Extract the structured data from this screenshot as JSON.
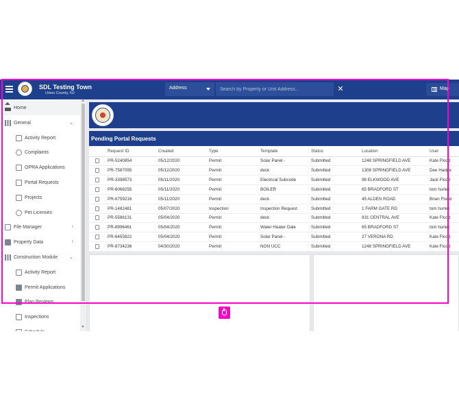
{
  "header": {
    "title": "SDL Testing Town",
    "subtitle": "Union County, NJ",
    "address_select": "Address",
    "search_placeholder": "Search by Property or Unit Address...",
    "clear_icon": "close-icon",
    "map_label": "Map",
    "bar_color": "#1d3f8c"
  },
  "sidebar": {
    "items": [
      {
        "label": "Home",
        "icon": "home-icon",
        "level": "top",
        "active": true
      },
      {
        "label": "General",
        "icon": "bank-icon",
        "level": "top",
        "chevron": "down"
      },
      {
        "label": "Activity Report",
        "icon": "chart-icon",
        "level": "child"
      },
      {
        "label": "Complaints",
        "icon": "alert-icon",
        "level": "child"
      },
      {
        "label": "OPRA Applications",
        "icon": "folder-icon",
        "level": "child"
      },
      {
        "label": "Portal Requests",
        "icon": "inbox-icon",
        "level": "child"
      },
      {
        "label": "Projects",
        "icon": "tree-icon",
        "level": "child"
      },
      {
        "label": "Pet Licenses",
        "icon": "paw-icon",
        "level": "child"
      },
      {
        "label": "File Manager",
        "icon": "folder-icon",
        "level": "top",
        "chevron": "left"
      },
      {
        "label": "Property Data",
        "icon": "building-icon",
        "level": "top",
        "chevron": "left"
      },
      {
        "label": "Construction Module",
        "icon": "grid-icon",
        "level": "top",
        "chevron": "down"
      },
      {
        "label": "Activity Report",
        "icon": "chart-icon",
        "level": "child"
      },
      {
        "label": "Permit Applications",
        "icon": "checkbox-icon",
        "level": "child"
      },
      {
        "label": "Plan Reviews",
        "icon": "pencil-icon",
        "level": "child"
      },
      {
        "label": "Inspections",
        "icon": "phone-icon",
        "level": "child"
      },
      {
        "label": "Schedule",
        "icon": "calendar-icon",
        "level": "child"
      }
    ]
  },
  "panel": {
    "title": "Pending Portal Requests",
    "columns": [
      "",
      "Request ID",
      "Created",
      "Type",
      "Template",
      "Status",
      "Location",
      "User"
    ],
    "rows": [
      [
        "PR-5240854",
        "05/12/2020",
        "Permit",
        "Solar Panel -",
        "Submitted",
        "1248 SPRINGFIELD AVE",
        "Kate Flood"
      ],
      [
        "PR-7587095",
        "05/12/2020",
        "Permit",
        "deck",
        "Submitted",
        "1308 SPRINGFIELD AVE",
        "Dee Hadge"
      ],
      [
        "PR-3398573",
        "05/11/2020",
        "Permit",
        "Electrical Subcode",
        "Submitted",
        "98 ELKWOOD AVE",
        "Jack Flood"
      ],
      [
        "PR-6068255",
        "05/11/2020",
        "Permit",
        "BOILER",
        "Submitted",
        "65 BRADFORD ST",
        "tom hurley"
      ],
      [
        "PR-6759216",
        "05/11/2020",
        "Permit",
        "deck",
        "Submitted",
        "45 ALDEN ROAD",
        "Brian Flood"
      ],
      [
        "PR-1482481",
        "05/07/2020",
        "Inspection",
        "Inspection Request",
        "Submitted",
        "1 FARM GATE RD",
        "tom hurley"
      ],
      [
        "PR-5586131",
        "05/04/2020",
        "Permit",
        "deck",
        "Submitted",
        "831 CENTRAL AVE",
        "Kate Flood"
      ],
      [
        "PR-8996461",
        "05/04/2020",
        "Permit",
        "Water Heater Dale",
        "Submitted",
        "65 BRADFORD ST",
        "tom hurley"
      ],
      [
        "PR-6455822",
        "05/04/2020",
        "Permit",
        "Solar Panel -",
        "Submitted",
        "27 VERONA RD",
        "Kate Flood"
      ],
      [
        "PR-8734236",
        "04/30/2020",
        "Permit",
        "NON UCC",
        "Submitted",
        "1248 SPRINGFIELD AVE",
        "Kate Flood"
      ]
    ]
  },
  "annotation": {
    "highlight_color": "#ff00cc",
    "cursor_icon": "hand-pointer-icon"
  }
}
